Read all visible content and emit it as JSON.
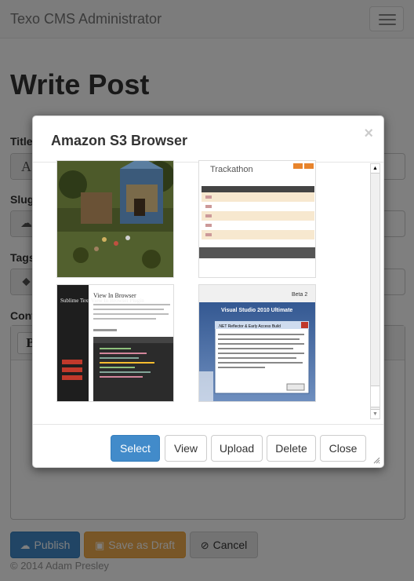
{
  "navbar": {
    "brand": "Texo CMS Administrator",
    "toggle_icon": "hamburger-icon"
  },
  "page": {
    "title": "Write Post",
    "fields": {
      "title_label": "Title",
      "title_addon": "A",
      "slug_label": "Slug",
      "tags_label": "Tags",
      "content_label": "Content",
      "editor_bold": "B"
    }
  },
  "actions": {
    "publish": "Publish",
    "save_draft": "Save as Draft",
    "cancel": "Cancel"
  },
  "footer": {
    "copyright": "© 2014 Adam Presley"
  },
  "modal": {
    "title": "Amazon S3 Browser",
    "close_glyph": "×",
    "thumbnails": [
      {
        "name": "game-village-screenshot"
      },
      {
        "name": "trackathon-screenshot",
        "caption": "Trackathon"
      },
      {
        "name": "view-in-browser-screenshot",
        "sidebar_text": "Sublime Text View In Browser Plugin",
        "heading": "View In Browser"
      },
      {
        "name": "visual-studio-screenshot",
        "logo": "Visual Studio 2010 Ultimate",
        "badge": "Beta 2",
        "dialog_title": ".NET Reflector & Early Access Build"
      }
    ],
    "buttons": {
      "select": "Select",
      "view": "View",
      "upload": "Upload",
      "delete": "Delete",
      "close": "Close"
    }
  },
  "colors": {
    "primary": "#428bca",
    "warning": "#f0ad4e",
    "navbar_bg": "#f8f8f8"
  }
}
